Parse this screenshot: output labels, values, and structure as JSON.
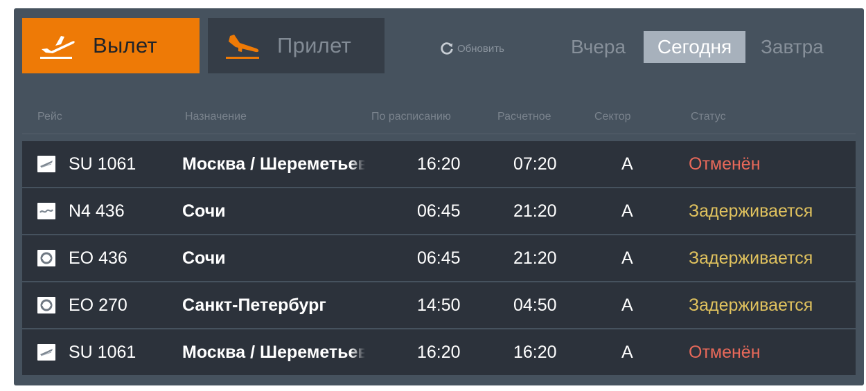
{
  "tabs": {
    "departure": {
      "label": "Вылет",
      "icon": "plane-takeoff-icon",
      "active": true,
      "color": "#ee7a06"
    },
    "arrival": {
      "label": "Прилет",
      "icon": "plane-landing-icon",
      "active": false
    }
  },
  "refresh": {
    "label": "Обновить",
    "icon": "refresh-icon"
  },
  "days": {
    "yesterday": "Вчера",
    "today": "Сегодня",
    "tomorrow": "Завтра",
    "selected": "today"
  },
  "columns": {
    "flight": "Рейс",
    "destination": "Назначение",
    "scheduled": "По расписанию",
    "estimated": "Расчетное",
    "sector": "Сектор",
    "status": "Статус"
  },
  "status_colors": {
    "cancelled": "#e8695a",
    "delayed": "#e0c25e"
  },
  "flights": [
    {
      "airline_logo": "aeroflot-logo",
      "flight": "SU 1061",
      "destination": "Москва / Шереметьево",
      "scheduled": "16:20",
      "estimated": "07:20",
      "sector": "A",
      "status": "Отменён",
      "status_type": "cancelled"
    },
    {
      "airline_logo": "nordwind-logo",
      "flight": "N4 436",
      "destination": "Сочи",
      "scheduled": "06:45",
      "estimated": "21:20",
      "sector": "A",
      "status": "Задерживается",
      "status_type": "delayed"
    },
    {
      "airline_logo": "eo-airline-logo",
      "flight": "EO 436",
      "destination": "Сочи",
      "scheduled": "06:45",
      "estimated": "21:20",
      "sector": "A",
      "status": "Задерживается",
      "status_type": "delayed"
    },
    {
      "airline_logo": "eo-airline-logo",
      "flight": "EO 270",
      "destination": "Санкт-Петербург",
      "scheduled": "14:50",
      "estimated": "04:50",
      "sector": "A",
      "status": "Задерживается",
      "status_type": "delayed"
    },
    {
      "airline_logo": "aeroflot-logo",
      "flight": "SU 1061",
      "destination": "Москва / Шереметьево",
      "scheduled": "16:20",
      "estimated": "16:20",
      "sector": "A",
      "status": "Отменён",
      "status_type": "cancelled"
    }
  ]
}
